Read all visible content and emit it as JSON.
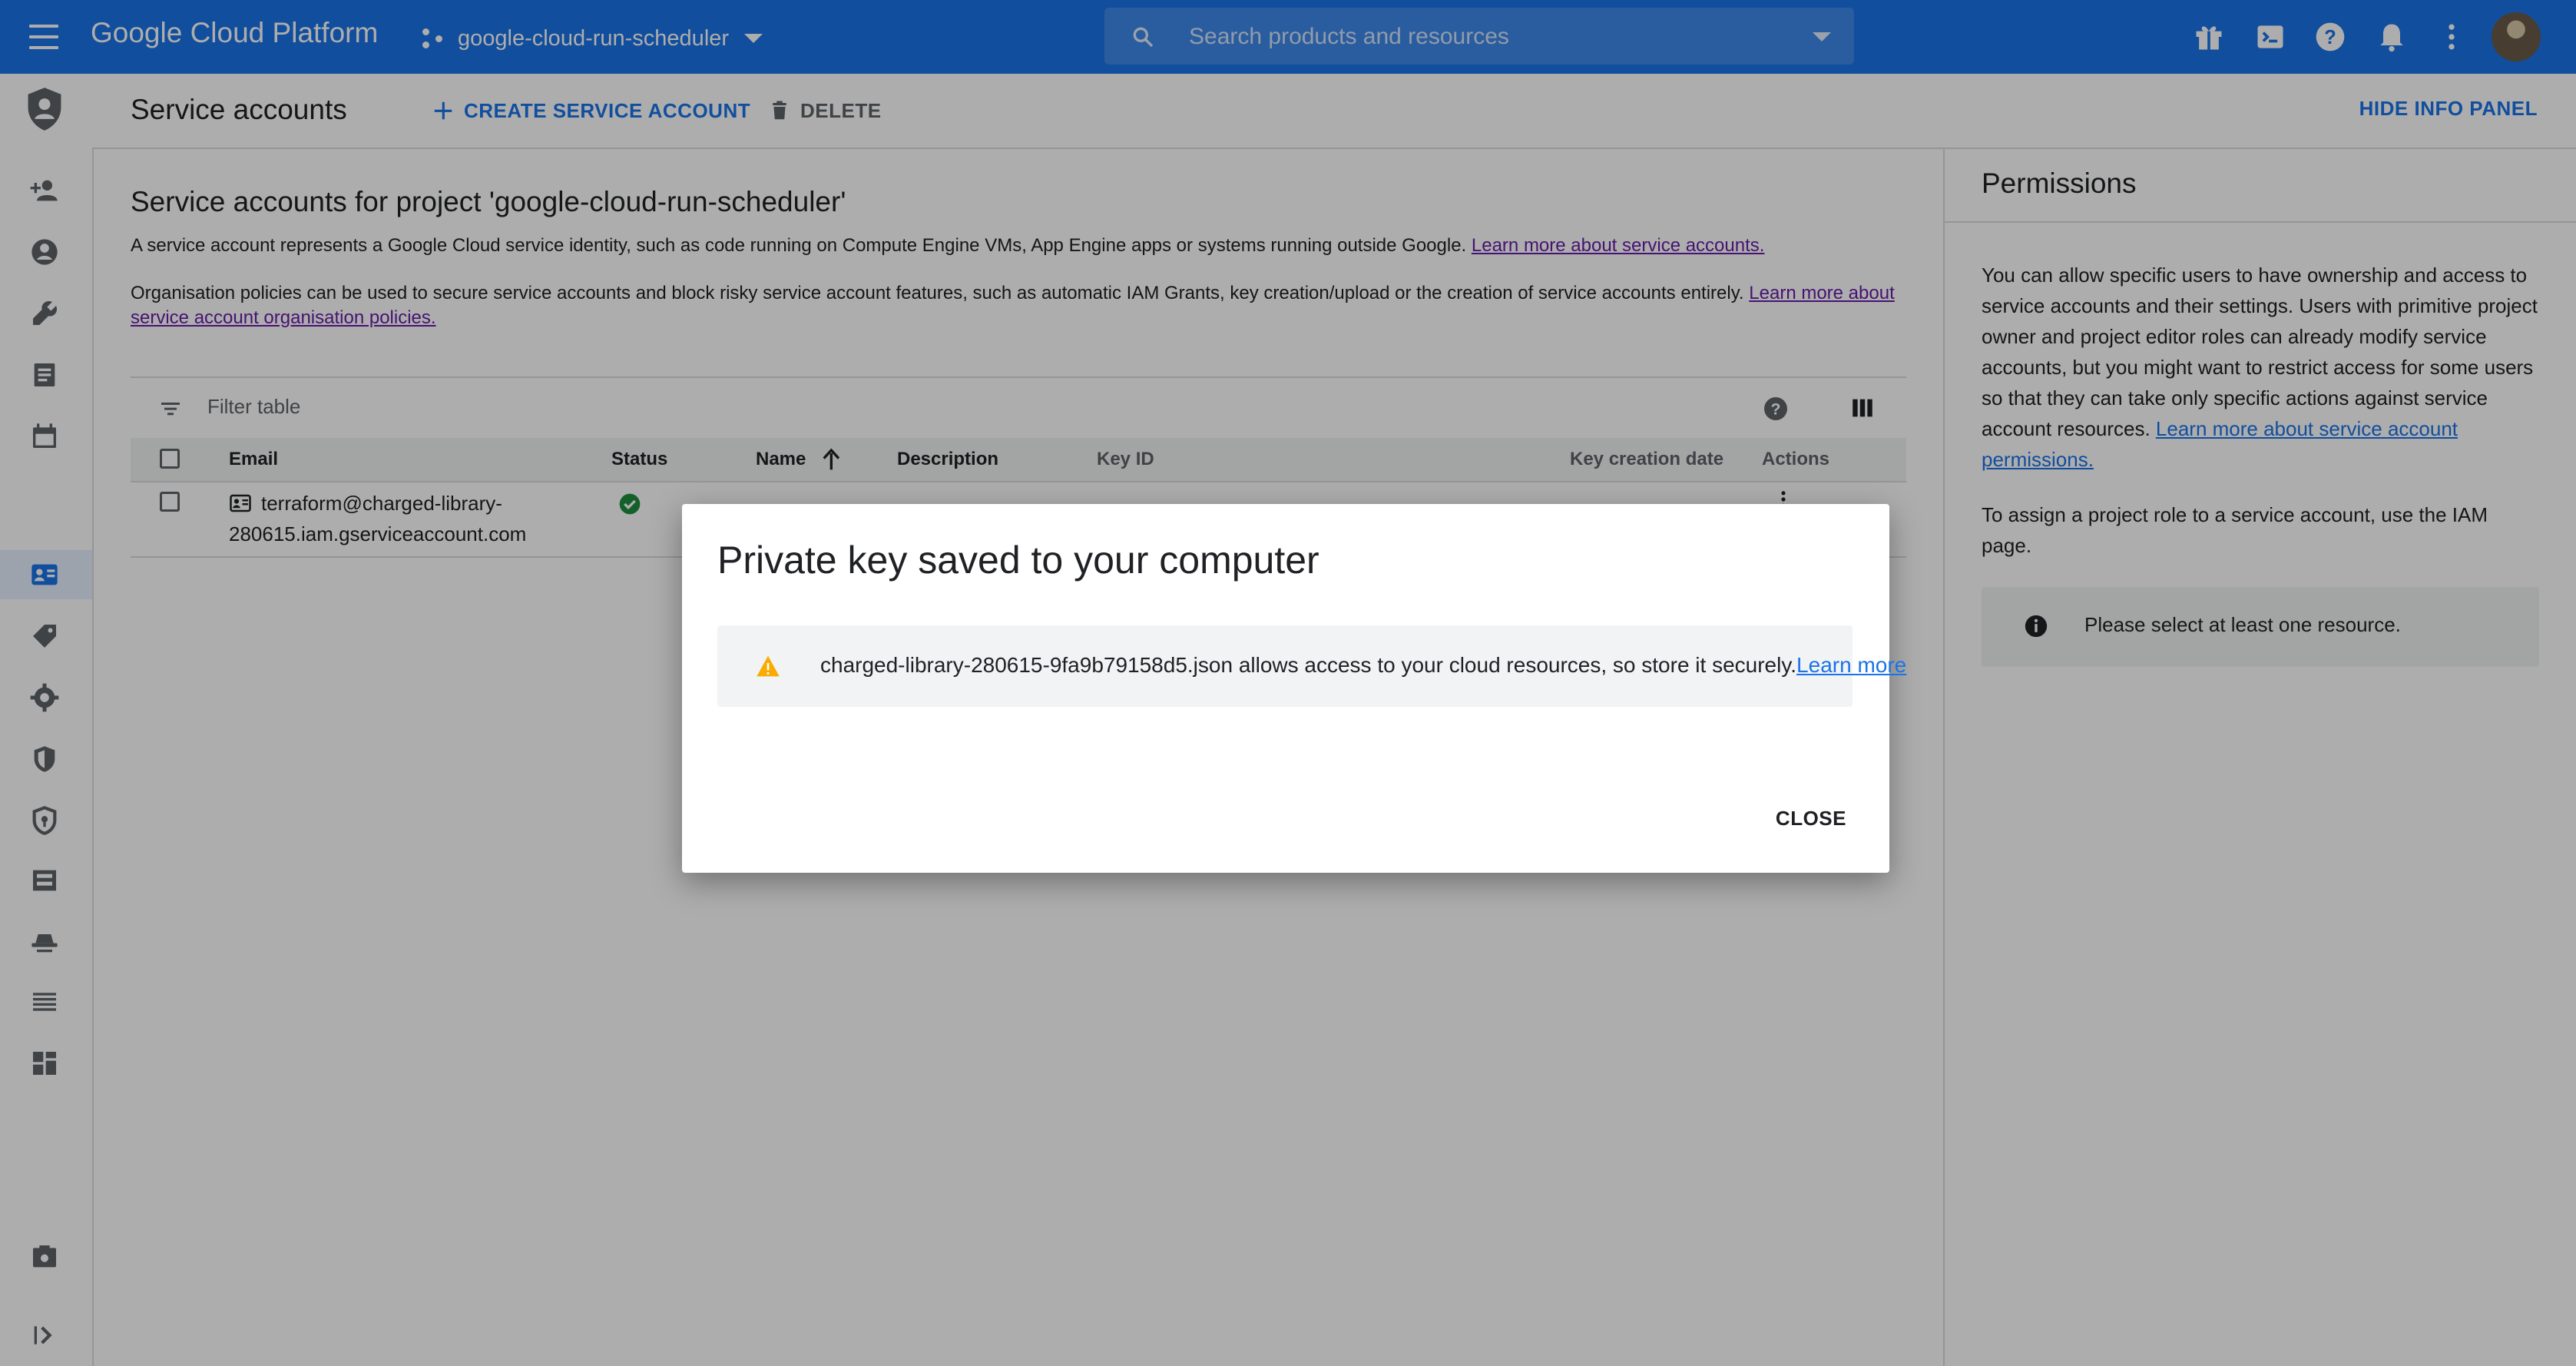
{
  "topbar": {
    "brand": "Google Cloud Platform",
    "project": "google-cloud-run-scheduler",
    "search_placeholder": "Search products and resources",
    "icons": [
      "menu-icon",
      "gift-icon",
      "cloud-shell-icon",
      "help-icon",
      "notifications-icon",
      "more-vert-icon",
      "avatar"
    ]
  },
  "rail": {
    "icons": [
      "iam-shield-icon",
      "person-add-icon",
      "account-circle-icon",
      "wrench-icon",
      "receipt-icon",
      "calendar-icon",
      "service-accounts-icon",
      "label-icon",
      "settings-icon",
      "security-icon",
      "privacy-icon",
      "dns-icon",
      "group-icon",
      "list-icon",
      "dashboard-icon",
      "release-notes-icon",
      "expand-icon"
    ],
    "selected": "service-accounts-icon"
  },
  "actionbar": {
    "title": "Service accounts",
    "create_label": "CREATE SERVICE ACCOUNT",
    "delete_label": "DELETE",
    "hide_label": "HIDE INFO PANEL"
  },
  "main": {
    "heading": "Service accounts for project 'google-cloud-run-scheduler'",
    "desc1": "A service account represents a Google Cloud service identity, such as code running on Compute Engine VMs, App Engine apps or systems running outside Google.",
    "desc1_link": "Learn more about service accounts.",
    "desc2": "Organisation policies can be used to secure service accounts and block risky service account features, such as automatic IAM Grants, key creation/upload or the creation of service accounts entirely.",
    "desc2_link": "Learn more about service account organisation policies.",
    "filter_placeholder": "Filter table",
    "columns": {
      "email": "Email",
      "status": "Status",
      "name": "Name",
      "description": "Description",
      "key_id": "Key ID",
      "key_date": "Key creation date",
      "actions": "Actions"
    },
    "row": {
      "email_line1": "terraform@charged-library-",
      "email_line2": "280615.iam.gserviceaccount.com",
      "status_icon": "check-circle-icon"
    }
  },
  "info": {
    "title": "Permissions",
    "p1": "You can allow specific users to have ownership and access to service accounts and their settings. Users with primitive project owner and project editor roles can already modify service accounts, but you might want to restrict access for some users so that they can take only specific actions against service account resources.",
    "p1_link": "Learn more about service account permissions.",
    "p2": "To assign a project role to a service account, use the IAM page.",
    "notice": "Please select at least one resource."
  },
  "dialog": {
    "title": "Private key saved to your computer",
    "message": "charged-library-280615-9fa9b79158d5.json allows access to your cloud resources, so store it securely.",
    "link": "Learn more",
    "close_label": "CLOSE"
  },
  "colors": {
    "brand_blue": "#1a73e8",
    "warning": "#f9ab00",
    "success": "#1e8e3e"
  }
}
